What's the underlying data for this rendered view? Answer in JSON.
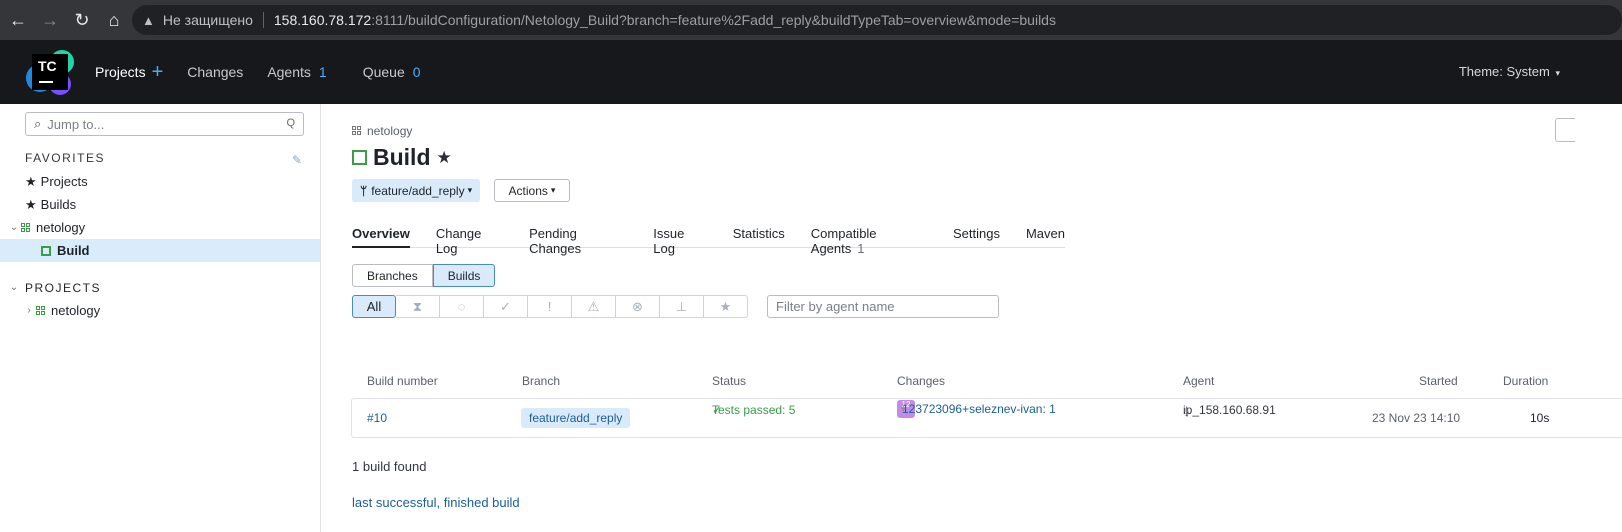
{
  "browser": {
    "security_label": "Не защищено",
    "url_host": "158.160.78.172",
    "url_rest": ":8111/buildConfiguration/Netology_Build?branch=feature%2Fadd_reply&buildTypeTab=overview&mode=builds"
  },
  "header": {
    "logo_text": "TC",
    "nav": {
      "projects": "Projects",
      "changes": "Changes",
      "agents": "Agents",
      "agents_count": "1",
      "queue": "Queue",
      "queue_count": "0"
    },
    "theme": "Theme: System"
  },
  "sidebar": {
    "search_placeholder": "Jump to...",
    "search_shortcut": "Q",
    "favorites_title": "FAVORITES",
    "favorites": {
      "projects": "Projects",
      "builds": "Builds",
      "netology": "netology",
      "build": "Build"
    },
    "projects_title": "PROJECTS",
    "projects": {
      "netology": "netology"
    }
  },
  "main": {
    "breadcrumb": "netology",
    "title": "Build",
    "branch": "feature/add_reply",
    "actions": "Actions",
    "tabs": {
      "overview": "Overview",
      "change_log": "Change Log",
      "pending_changes": "Pending Changes",
      "issue_log": "Issue Log",
      "statistics": "Statistics",
      "compatible_agents": "Compatible Agents",
      "compatible_agents_count": "1",
      "settings": "Settings",
      "maven": "Maven"
    },
    "view_modes": {
      "branches": "Branches",
      "builds": "Builds"
    },
    "filter_all": "All",
    "agent_filter_placeholder": "Filter by agent name",
    "columns": {
      "build_number": "Build number",
      "branch": "Branch",
      "status": "Status",
      "changes": "Changes",
      "agent": "Agent",
      "started": "Started",
      "duration": "Duration"
    },
    "builds": [
      {
        "number": "#10",
        "branch": "feature/add_reply",
        "status": "Tests passed: 5",
        "changes": "123723096+seleznev-ivan: 1",
        "avatar": "12",
        "agent": "ip_158.160.68.91",
        "started": "23 Nov 23 14:10",
        "duration": "10s"
      }
    ],
    "found": "1 build found",
    "last_successful": "last successful, finished build"
  }
}
